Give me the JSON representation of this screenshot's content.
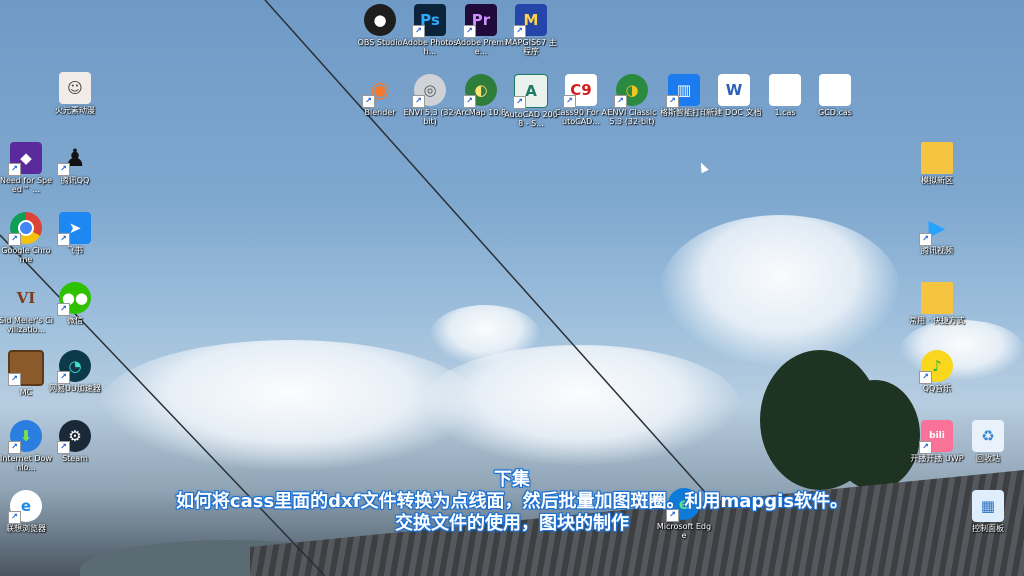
{
  "desktop_icons": {
    "obs": "OBS Studio",
    "photoshop": "Adobe Photosh...",
    "premiere": "Adobe Premie...",
    "mapgis": "MAPGIS67 主程序",
    "huoshao": "火元素动漫",
    "blender": "Blender",
    "envi53": "ENVI 5.3 (32-bit)",
    "arcmap": "ArcMap 10.8",
    "autocad": "AutoCAD 2008 - S...",
    "cass90": "Cass90 For AutoCAD...",
    "envi_classic": "ENVI Classic 5.3 (32-bit)",
    "hengxing": "格斯智能打印",
    "new_doc": "新建 DOC 文档",
    "one_cas": "1.cas",
    "gcd": "GCD.cas",
    "nfs": "Need for Speed™ ...",
    "qq": "腾讯QQ",
    "chrome": "Google Chrome",
    "feishu": "飞书",
    "civ": "Sid Meier's Civilizatio...",
    "wechat": "微信",
    "mc": "MC",
    "uu": "网易UU加速器",
    "ie": "Internet Downlo...",
    "steam": "Steam",
    "edge_browser": "联想浏览器",
    "folder1": "模拟新区",
    "tencent_video": "腾讯视频",
    "folder2": "常用 · 快捷方式",
    "qqmusic": "QQ音乐",
    "bilibili": "开播开播 UWP",
    "recycle": "回收站",
    "ms_edge": "Microsoft Edge",
    "control_panel": "控制面板"
  },
  "subtitles": {
    "line1": "下集",
    "line2": "如何将cass里面的dxf文件转换为点线面，然后批量加图斑圈。利用mapgis软件。",
    "line3": "交换文件的使用，图块的制作"
  },
  "colors": {
    "subtitle_outline": "#1b6fd0",
    "sky": "#7fa8cf"
  }
}
